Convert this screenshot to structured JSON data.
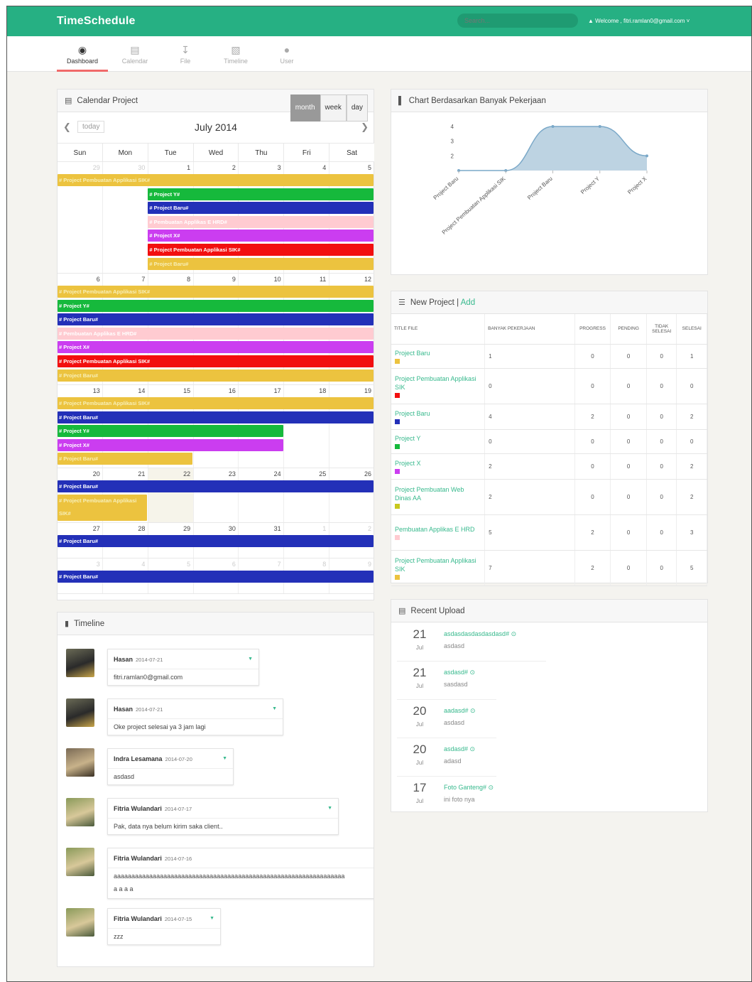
{
  "app": {
    "brand": "TimeSchedule",
    "search_placeholder": "Search...",
    "welcome": "Welcome , fitri.ramlan0@gmail.com"
  },
  "nav": [
    {
      "label": "Dashboard",
      "icon": "dashboard-icon"
    },
    {
      "label": "Calendar",
      "icon": "calendar-icon"
    },
    {
      "label": "File",
      "icon": "file-icon"
    },
    {
      "label": "Timeline",
      "icon": "timeline-icon"
    },
    {
      "label": "User",
      "icon": "user-icon"
    }
  ],
  "calendar": {
    "panel_title": "Calendar Project",
    "views": [
      "month",
      "week",
      "day"
    ],
    "active_view": "month",
    "today_label": "today",
    "title": "July 2014",
    "day_names": [
      "Sun",
      "Mon",
      "Tue",
      "Wed",
      "Thu",
      "Fri",
      "Sat"
    ],
    "weeks": [
      {
        "days": [
          "29",
          "30",
          "1",
          "2",
          "3",
          "4",
          "5"
        ],
        "other": [
          0,
          1
        ],
        "events": [
          {
            "label": "# Project Pembuatan Applikasi SIK#",
            "color": "y",
            "start": 0,
            "end": 7,
            "row": 0
          },
          {
            "label": "# Project Y#",
            "color": "g",
            "start": 2,
            "end": 7,
            "row": 1
          },
          {
            "label": "# Project Baru#",
            "color": "b",
            "start": 2,
            "end": 7,
            "row": 2
          },
          {
            "label": "# Pembuatan Applikas E HRD#",
            "color": "p",
            "start": 2,
            "end": 7,
            "row": 3
          },
          {
            "label": "# Project X#",
            "color": "v",
            "start": 2,
            "end": 7,
            "row": 4
          },
          {
            "label": "# Project Pembuatan Applikasi SIK#",
            "color": "r",
            "start": 2,
            "end": 7,
            "row": 5
          },
          {
            "label": "# Project Baru#",
            "color": "y",
            "start": 2,
            "end": 7,
            "row": 6
          }
        ]
      },
      {
        "days": [
          "6",
          "7",
          "8",
          "9",
          "10",
          "11",
          "12"
        ],
        "other": [],
        "events": [
          {
            "label": "# Project Pembuatan Applikasi SIK#",
            "color": "y",
            "start": 0,
            "end": 7,
            "row": 0
          },
          {
            "label": "# Project Y#",
            "color": "g",
            "start": 0,
            "end": 7,
            "row": 1
          },
          {
            "label": "# Project Baru#",
            "color": "b",
            "start": 0,
            "end": 7,
            "row": 2
          },
          {
            "label": "# Pembuatan Applikas E HRD#",
            "color": "p",
            "start": 0,
            "end": 7,
            "row": 3
          },
          {
            "label": "# Project X#",
            "color": "v",
            "start": 0,
            "end": 7,
            "row": 4
          },
          {
            "label": "# Project Pembuatan Applikasi SIK#",
            "color": "r",
            "start": 0,
            "end": 7,
            "row": 5
          },
          {
            "label": "# Project Baru#",
            "color": "y",
            "start": 0,
            "end": 7,
            "row": 6
          }
        ]
      },
      {
        "days": [
          "13",
          "14",
          "15",
          "16",
          "17",
          "18",
          "19"
        ],
        "other": [],
        "events": [
          {
            "label": "# Project Pembuatan Applikasi SIK#",
            "color": "y",
            "start": 0,
            "end": 7,
            "row": 0
          },
          {
            "label": "# Project Baru#",
            "color": "b",
            "start": 0,
            "end": 7,
            "row": 1
          },
          {
            "label": "# Project Y#",
            "color": "g",
            "start": 0,
            "end": 5,
            "row": 2
          },
          {
            "label": "# Project X#",
            "color": "v",
            "start": 0,
            "end": 5,
            "row": 3
          },
          {
            "label": "# Project Baru#",
            "color": "y",
            "start": 0,
            "end": 3,
            "row": 4
          }
        ]
      },
      {
        "days": [
          "20",
          "21",
          "22",
          "23",
          "24",
          "25",
          "26"
        ],
        "other": [],
        "highlight": 2,
        "events": [
          {
            "label": "# Project Baru#",
            "color": "b",
            "start": 0,
            "end": 7,
            "row": 0
          },
          {
            "label": "# Project Pembuatan Applikasi SIK#",
            "color": "y",
            "start": 0,
            "end": 2,
            "row": 1,
            "rows": 2
          }
        ]
      },
      {
        "days": [
          "27",
          "28",
          "29",
          "30",
          "31",
          "1",
          "2"
        ],
        "other": [
          5,
          6
        ],
        "events": [
          {
            "label": "# Project Baru#",
            "color": "b",
            "start": 0,
            "end": 7,
            "row": 0
          }
        ]
      },
      {
        "days": [
          "3",
          "4",
          "5",
          "6",
          "7",
          "8",
          "9"
        ],
        "other": [
          0,
          1,
          2,
          3,
          4,
          5,
          6
        ],
        "events": [
          {
            "label": "# Project Baru#",
            "color": "b",
            "start": 0,
            "end": 7,
            "row": 0
          }
        ]
      }
    ]
  },
  "chart_panel": {
    "title": "Chart Berdasarkan Banyak Pekerjaan"
  },
  "chart_data": {
    "type": "area",
    "categories": [
      "Project Baru",
      "Project Pembuatan Applikasi SIK",
      "Project Baru",
      "Project Y",
      "Project X"
    ],
    "values": [
      1,
      1,
      4,
      4,
      2
    ],
    "y_ticks": [
      "2",
      "3",
      "4"
    ],
    "color": "#a7c4d8"
  },
  "new_project": {
    "title": "New Project",
    "separator": "|",
    "add_label": "Add",
    "columns": [
      "TITLE FILE",
      "BANYAK PEKERJAAN",
      "PROGRESS",
      "PENDING",
      "TIDAK SELESAI",
      "SELESAI"
    ],
    "rows": [
      {
        "title": "Project Baru",
        "color": "#ecc33f",
        "cells": [
          "1",
          "0",
          "0",
          "0",
          "1"
        ]
      },
      {
        "title": "Project Pembuatan Applikasi SIK",
        "color": "#f20f0f",
        "cells": [
          "0",
          "0",
          "0",
          "0",
          "0"
        ]
      },
      {
        "title": "Project Baru",
        "color": "#2330b8",
        "cells": [
          "4",
          "2",
          "0",
          "0",
          "2"
        ]
      },
      {
        "title": "Project Y",
        "color": "#16b93c",
        "cells": [
          "0",
          "0",
          "0",
          "0",
          "0"
        ]
      },
      {
        "title": "Project X",
        "color": "#cb3df0",
        "cells": [
          "2",
          "0",
          "0",
          "0",
          "2"
        ]
      },
      {
        "title": "Project Pembuatan Web Dinas AA",
        "color": "#c8c81e",
        "cells": [
          "2",
          "0",
          "0",
          "0",
          "2"
        ]
      },
      {
        "title": "Pembuatan Applikas E HRD",
        "color": "#ffcbd1",
        "cells": [
          "5",
          "2",
          "0",
          "0",
          "3"
        ]
      },
      {
        "title": "Project Pembuatan Applikasi SIK",
        "color": "#ecc33f",
        "cells": [
          "7",
          "2",
          "0",
          "0",
          "5"
        ]
      }
    ]
  },
  "recent_upload": {
    "title": "Recent Upload",
    "items": [
      {
        "day": "21",
        "month": "Jul",
        "name": "asdasdasdasdasdasd#",
        "desc": "asdasd"
      },
      {
        "day": "21",
        "month": "Jul",
        "name": "asdasd#",
        "desc": "sasdasd"
      },
      {
        "day": "20",
        "month": "Jul",
        "name": "aadasd#",
        "desc": "asdasd"
      },
      {
        "day": "20",
        "month": "Jul",
        "name": "asdasd#",
        "desc": "adasd"
      },
      {
        "day": "17",
        "month": "Jul",
        "name": "Foto Ganteng#",
        "desc": "ini foto nya"
      }
    ]
  },
  "timeline": {
    "title": "Timeline",
    "items": [
      {
        "name": "Hasan",
        "date": "2014-07-21",
        "text": "fitri.ramlan0@gmail.com"
      },
      {
        "name": "Hasan",
        "date": "2014-07-21",
        "text": "Oke project selesai ya 3 jam lagi"
      },
      {
        "name": "Indra Lesamana",
        "date": "2014-07-20",
        "text": "asdasd"
      },
      {
        "name": "Fitria Wulandari",
        "date": "2014-07-17",
        "text": "Pak, data nya belum kirim saka client.."
      },
      {
        "name": "Fitria Wulandari",
        "date": "2014-07-16",
        "text": "aaaaaaaaaaaaaaaaaaaaaaaaaaaaaaaaaaaaaaaaaaaaaaaaaaaaaaaaaaaaaaaaa",
        "text2": "a a a a"
      },
      {
        "name": "Fitria Wulandari",
        "date": "2014-07-15",
        "text": "zzz"
      }
    ]
  }
}
